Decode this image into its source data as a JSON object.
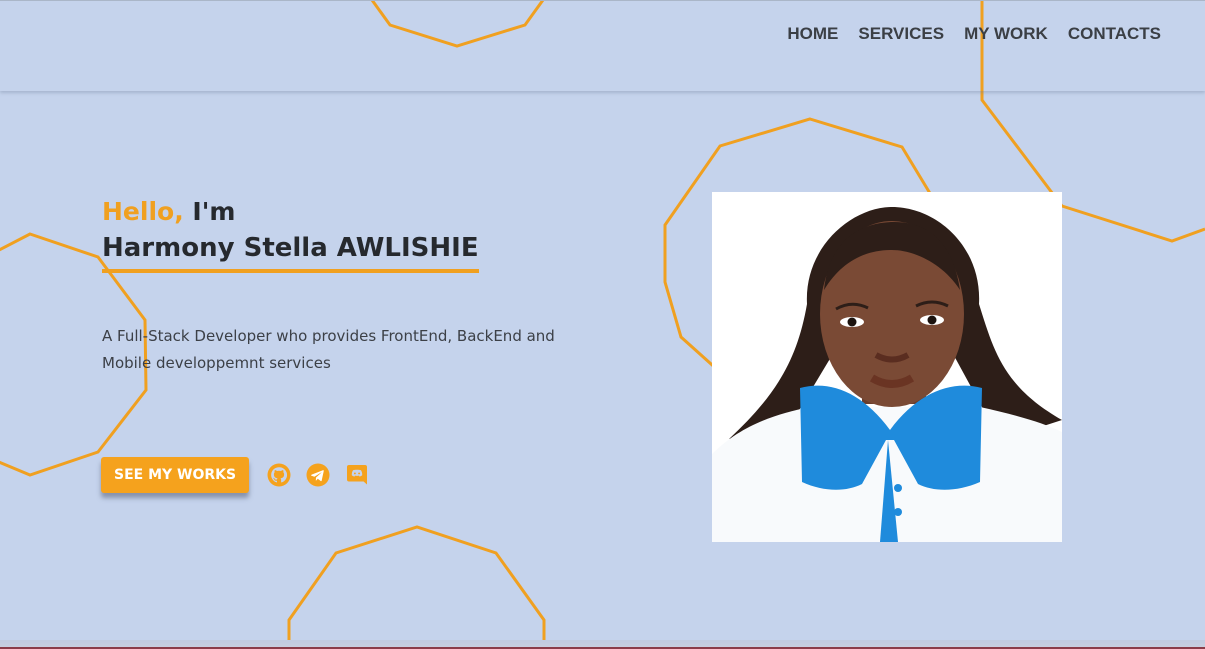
{
  "nav": {
    "items": [
      {
        "label": "HOME"
      },
      {
        "label": "SERVICES"
      },
      {
        "label": "MY WORK"
      },
      {
        "label": "CONTACTS"
      }
    ]
  },
  "hero": {
    "hello": "Hello,",
    "im": "I'm",
    "name": "Harmony Stella AWLISHIE",
    "description": "A Full-Stack Developer who provides FrontEnd, BackEnd and Mobile developpemnt services",
    "cta_label": "SEE MY WORKS"
  },
  "socials": [
    {
      "icon": "github-icon"
    },
    {
      "icon": "telegram-icon"
    },
    {
      "icon": "discord-icon"
    }
  ],
  "colors": {
    "accent": "#f5a21d",
    "background": "#c5d3ec",
    "text": "#26292e"
  }
}
